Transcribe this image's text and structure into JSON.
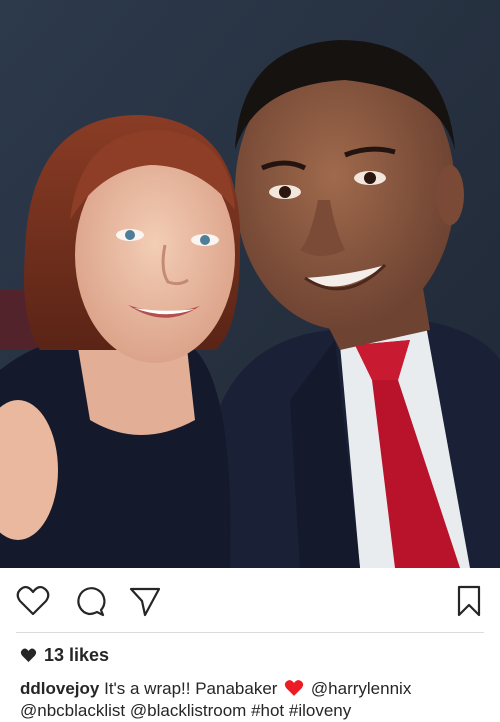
{
  "post": {
    "photo_alt": "selfie of two people",
    "likes": "13 likes",
    "username": "ddlovejoy",
    "caption_text": "It's a wrap!! Panabaker",
    "heart_emoji": "red-heart-emoji",
    "mention_1": "@harrylennix",
    "mention_2": "@nbcblacklist",
    "mention_3": "@blacklistroom",
    "hashtag_1": "#hot",
    "hashtag_2": "#iloveny"
  },
  "icons": {
    "like": "heart-outline-icon",
    "comment": "speech-bubble-icon",
    "share": "paper-plane-icon",
    "save": "bookmark-icon"
  },
  "colors": {
    "text": "#262626",
    "divider": "#dbdbdb",
    "heart_red": "#ed1c24"
  }
}
